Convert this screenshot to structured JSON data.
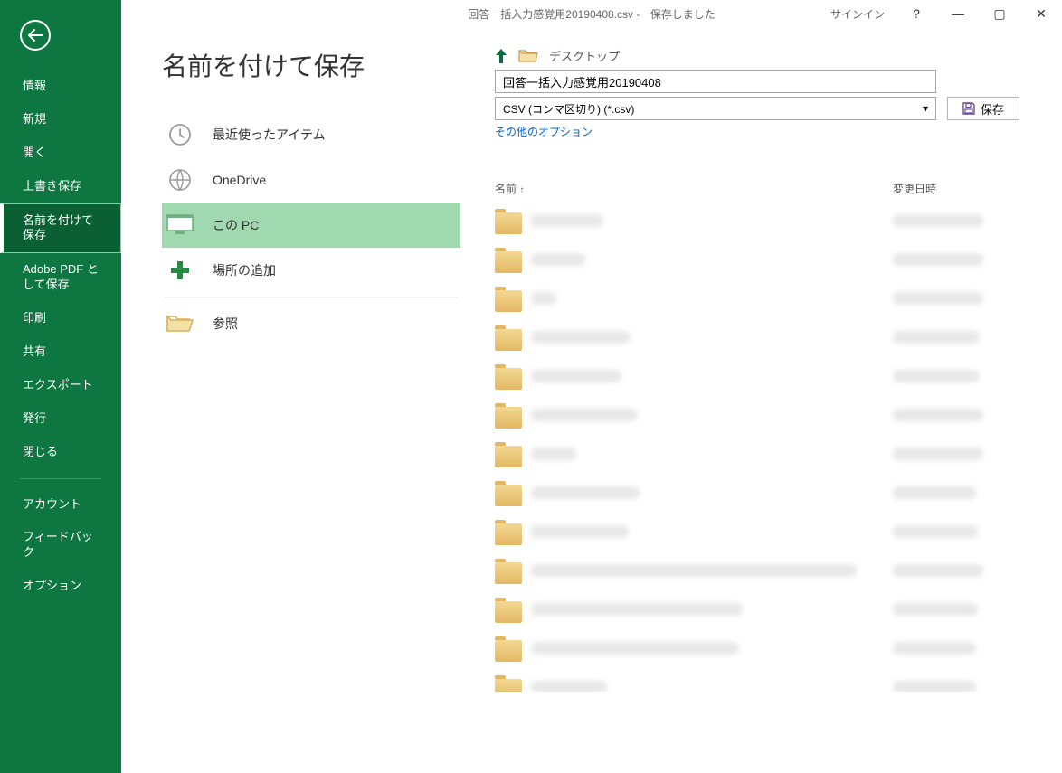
{
  "titlebar": {
    "filename": "回答一括入力感覚用20190408.csv",
    "separator": " - ",
    "status": "保存しました",
    "signin": "サインイン",
    "help": "?",
    "minimize": "—",
    "maximize": "▢",
    "close": "✕"
  },
  "sidebar": {
    "items": [
      "情報",
      "新規",
      "開く",
      "上書き保存",
      "名前を付けて保存",
      "Adobe PDF として保存",
      "印刷",
      "共有",
      "エクスポート",
      "発行",
      "閉じる"
    ],
    "bottom_items": [
      "アカウント",
      "フィードバック",
      "オプション"
    ]
  },
  "page": {
    "title": "名前を付けて保存"
  },
  "locations": {
    "recent": "最近使ったアイテム",
    "onedrive": "OneDrive",
    "this_pc": "この PC",
    "add_place": "場所の追加",
    "browse": "参照"
  },
  "save_panel": {
    "up_tooltip": "上へ",
    "breadcrumb": "デスクトップ",
    "filename": "回答一括入力感覚用20190408",
    "filetype": "CSV (コンマ区切り) (*.csv)",
    "save_label": "保存",
    "more_options": "その他のオプション"
  },
  "file_list": {
    "col_name": "名前",
    "col_date": "変更日時",
    "sort_indicator": "↑",
    "rows": [
      {
        "name_width": 80,
        "date_width": 100
      },
      {
        "name_width": 60,
        "date_width": 100
      },
      {
        "name_width": 28,
        "date_width": 100
      },
      {
        "name_width": 110,
        "date_width": 96
      },
      {
        "name_width": 100,
        "date_width": 96
      },
      {
        "name_width": 118,
        "date_width": 100
      },
      {
        "name_width": 50,
        "date_width": 100
      },
      {
        "name_width": 120,
        "date_width": 92
      },
      {
        "name_width": 108,
        "date_width": 94
      },
      {
        "name_width": 360,
        "date_width": 100
      },
      {
        "name_width": 234,
        "date_width": 94
      },
      {
        "name_width": 230,
        "date_width": 92
      },
      {
        "name_width": 84,
        "date_width": 92
      }
    ]
  }
}
